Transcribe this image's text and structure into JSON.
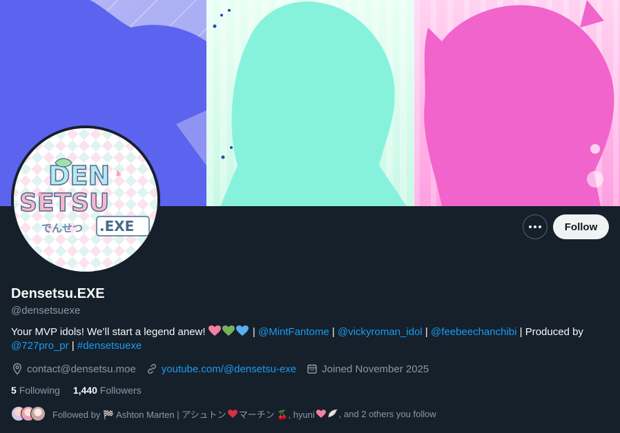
{
  "profile": {
    "display_name": "Densetsu.EXE",
    "handle": "@densetsuexe"
  },
  "actions": {
    "more_label": "More",
    "follow_label": "Follow"
  },
  "bio": {
    "text_before": "Your MVP idols! We’ll start a legend anew!",
    "hearts": [
      "pink-heart",
      "green-heart",
      "blue-heart"
    ],
    "sep1": " | ",
    "mention1": "@MintFantome",
    "sep2": " | ",
    "mention2": "@vickyroman_idol",
    "sep3": " | ",
    "mention3": "@feebeechanchibi",
    "produced_by": " | Produced by ",
    "mention4": "@727pro_pr",
    "sep4": " | ",
    "hashtag": "#densetsuexe"
  },
  "meta": {
    "location": "contact@densetsu.moe",
    "link": "youtube.com/@densetsu-exe",
    "joined": "Joined November 2025"
  },
  "stats": {
    "following_count": "5",
    "following_label": "Following",
    "followers_count": "1,440",
    "followers_label": "Followers"
  },
  "followed_by": {
    "prefix": "Followed by 🏁 Ashton Marten | アシュトン",
    "middle": "マーチン 🍒, hyuni",
    "suffix": ", and 2 others you follow"
  },
  "logo": {
    "line1": "DEN",
    "line2": "SETSU",
    "kana": "でんせつ",
    "exe": ".EXE"
  },
  "colors": {
    "background": "#15202b",
    "accent": "#1d9bf0",
    "muted": "#8b98a5",
    "banner_left": "#5c63ee",
    "banner_mid": "#86f2dc",
    "banner_right": "#f064cc"
  }
}
